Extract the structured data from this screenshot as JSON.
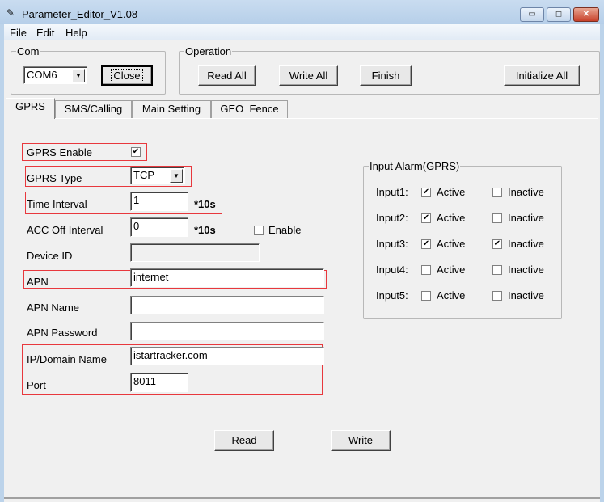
{
  "window": {
    "title": "Parameter_Editor_V1.08",
    "minimize": "▭",
    "maximize": "◻",
    "close": "✕"
  },
  "menu": [
    "File",
    "Edit",
    "Help"
  ],
  "com": {
    "label": "Com",
    "port": "COM6",
    "close_label": "Close"
  },
  "operation": {
    "label": "Operation",
    "read_all": "Read All",
    "write_all": "Write All",
    "finish": "Finish",
    "initialize_all": "Initialize All"
  },
  "tabs": [
    {
      "label": "GPRS",
      "selected": true
    },
    {
      "label": "SMS/Calling"
    },
    {
      "label": "Main Setting"
    },
    {
      "label": "GEO  Fence"
    }
  ],
  "gprs": {
    "enable_label": "GPRS Enable",
    "enable_checked": true,
    "type_label": "GPRS Type",
    "type_value": "TCP",
    "time_interval_label": "Time Interval",
    "time_interval_value": "1",
    "time_interval_unit": "*10s",
    "acc_off_label": "ACC Off Interval",
    "acc_off_value": "0",
    "acc_off_unit": "*10s",
    "acc_enable_label": "Enable",
    "acc_enable_checked": false,
    "device_id_label": "Device ID",
    "device_id_value": "",
    "apn_label": "APN",
    "apn_value": "internet",
    "apn_name_label": "APN Name",
    "apn_name_value": "",
    "apn_password_label": "APN Password",
    "apn_password_value": "",
    "ip_label": "IP/Domain Name",
    "ip_value": "istartracker.com",
    "port_label": "Port",
    "port_value": "8011",
    "read_label": "Read",
    "write_label": "Write"
  },
  "input_alarm": {
    "label": "Input Alarm(GPRS)",
    "active_label": "Active",
    "inactive_label": "Inactive",
    "inputs": [
      {
        "name": "Input1:",
        "active": true,
        "inactive": false
      },
      {
        "name": "Input2:",
        "active": true,
        "inactive": false
      },
      {
        "name": "Input3:",
        "active": true,
        "inactive": true
      },
      {
        "name": "Input4:",
        "active": false,
        "inactive": false
      },
      {
        "name": "Input5:",
        "active": false,
        "inactive": false
      }
    ]
  },
  "colors": {
    "highlight": "#e8383d",
    "face": "#f0f0f0",
    "frame": "#bcd3ea"
  }
}
